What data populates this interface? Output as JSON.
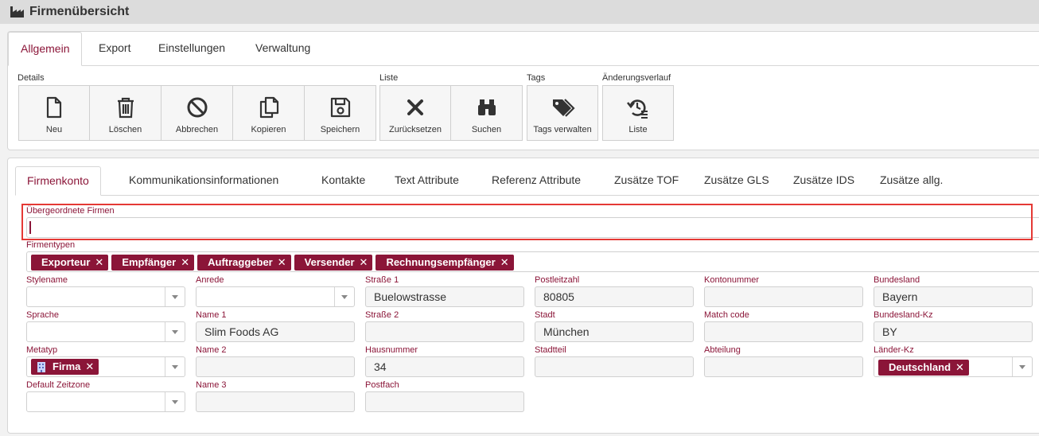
{
  "titlebar": {
    "title": "Firmenübersicht",
    "icon": "factory-icon"
  },
  "top_tabs": [
    "Allgemein",
    "Export",
    "Einstellungen",
    "Verwaltung"
  ],
  "ribbon": {
    "groups": [
      "Details",
      "Liste",
      "Tags",
      "Änderungsverlauf"
    ],
    "buttons": [
      "Neu",
      "Löschen",
      "Abbrechen",
      "Kopieren",
      "Speichern",
      "Zurücksetzen",
      "Suchen",
      "Tags verwalten",
      "Liste"
    ]
  },
  "form_tabs": [
    "Firmenkonto",
    "Kommunikationsinformationen",
    "Kontakte",
    "Text Attribute",
    "Referenz Attribute",
    "Zusätze TOF",
    "Zusätze GLS",
    "Zusätze IDS",
    "Zusätze allg."
  ],
  "form": {
    "parent_label": "Übergeordnete Firmen",
    "types_label": "Firmentypen",
    "types": [
      "Exporteur",
      "Empfänger",
      "Auftraggeber",
      "Versender",
      "Rechnungsempfänger"
    ],
    "labels": {
      "stylename": "Stylename",
      "sprache": "Sprache",
      "metatyp": "Metatyp",
      "zeitzone": "Default Zeitzone",
      "anrede": "Anrede",
      "name1": "Name 1",
      "name2": "Name 2",
      "name3": "Name 3",
      "strasse1": "Straße 1",
      "strasse2": "Straße 2",
      "hausnummer": "Hausnummer",
      "postfach": "Postfach",
      "plz": "Postleitzahl",
      "stadt": "Stadt",
      "stadtteil": "Stadtteil",
      "konto": "Kontonummer",
      "match": "Match code",
      "abteilung": "Abteilung",
      "bundesland": "Bundesland",
      "bundesland_kz": "Bundesland-Kz",
      "laender_kz": "Länder-Kz"
    },
    "values": {
      "name1": "Slim Foods AG",
      "strasse1": "Buelowstrasse",
      "hausnummer": "34",
      "plz": "80805",
      "stadt": "München",
      "bundesland": "Bayern",
      "bundesland_kz": "BY",
      "metatyp": "Firma",
      "laender_kz": "Deutschland"
    }
  },
  "colors": {
    "accent": "#8b1538",
    "highlight": "#e53935"
  }
}
